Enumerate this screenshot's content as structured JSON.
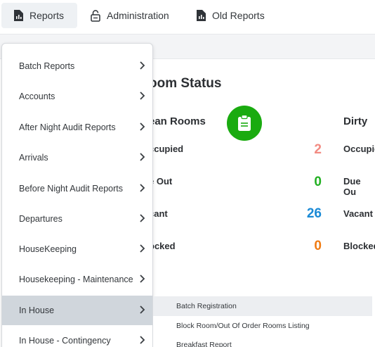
{
  "nav": {
    "tabs": [
      {
        "label": "Reports",
        "icon": "report-icon",
        "active": true
      },
      {
        "label": "Administration",
        "icon": "lock-icon"
      },
      {
        "label": "Old Reports",
        "icon": "report-icon"
      }
    ]
  },
  "status": {
    "title": "oom Status",
    "clean_head": "ean Rooms",
    "dirty_head": "Dirty",
    "rows": [
      {
        "label": "ccupied",
        "value": "2",
        "color": "#f28b82",
        "dirty_label": "Occupie"
      },
      {
        "label": "e Out",
        "value": "0",
        "color": "#22b022",
        "dirty_label": "Due Ou"
      },
      {
        "label": "cant",
        "value": "26",
        "color": "#1a8ad6",
        "dirty_label": "Vacant"
      },
      {
        "label": "ocked",
        "value": "0",
        "color": "#f07b12",
        "dirty_label": "Blocked"
      }
    ],
    "accent": "#1aab10"
  },
  "dropdown": {
    "items": [
      {
        "label": "Batch Reports"
      },
      {
        "label": "Accounts"
      },
      {
        "label": "After Night Audit Reports"
      },
      {
        "label": "Arrivals"
      },
      {
        "label": "Before Night Audit Reports"
      },
      {
        "label": "Departures"
      },
      {
        "label": "HouseKeeping"
      },
      {
        "label": "Housekeeping - Maintenance"
      },
      {
        "label": "In House",
        "active": true
      },
      {
        "label": "In House - Contingency"
      }
    ]
  },
  "submenu": {
    "items": [
      {
        "label": "Batch Registration"
      },
      {
        "label": "Block Room/Out Of Order Rooms Listing"
      },
      {
        "label": "Breakfast Report"
      }
    ]
  }
}
